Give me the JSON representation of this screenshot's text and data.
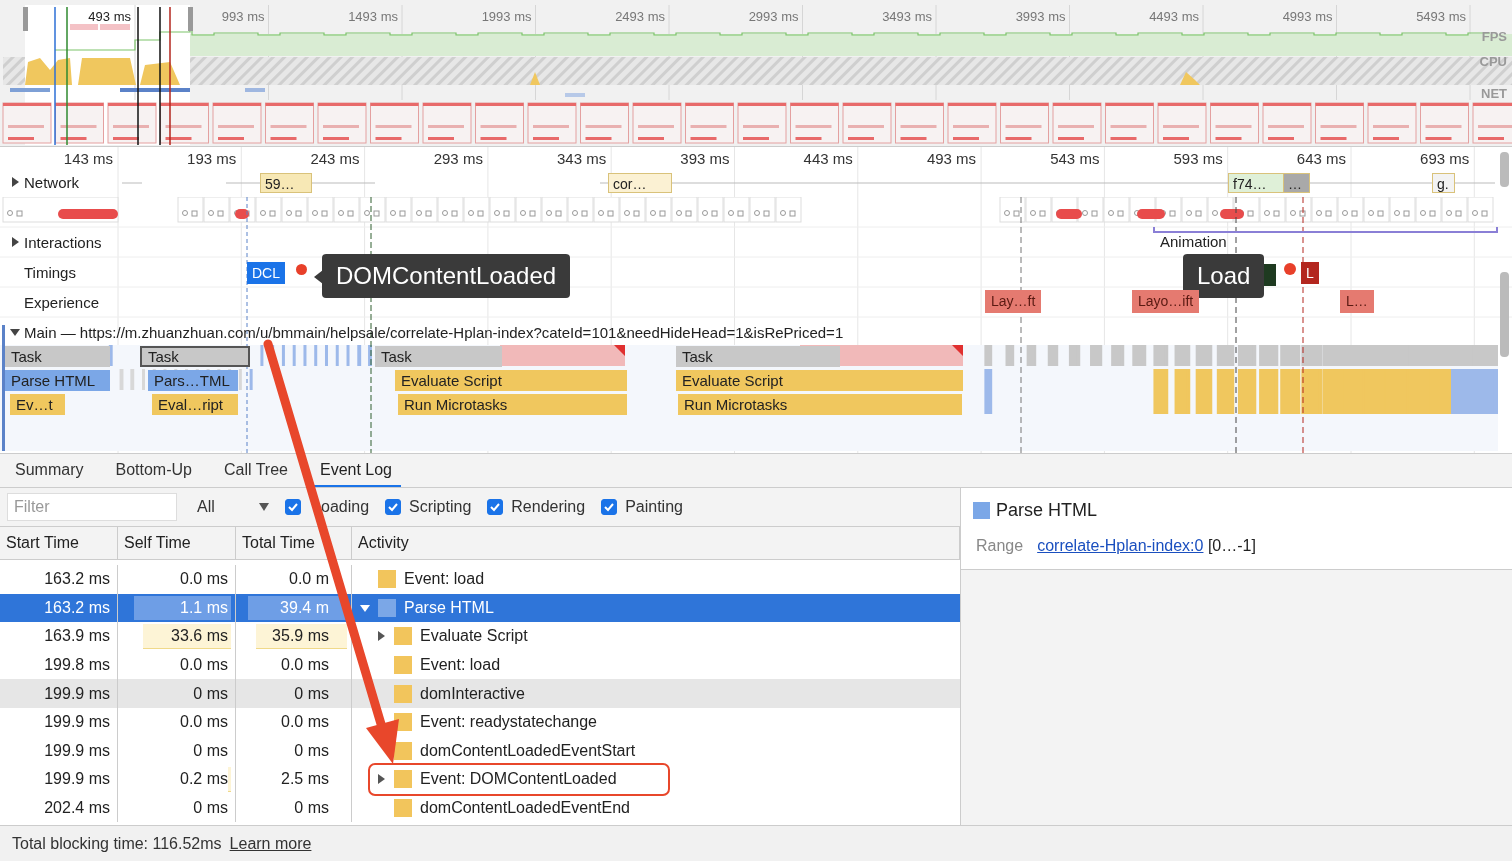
{
  "overview": {
    "selection_label": "493 ms",
    "ticks": [
      "993 ms",
      "1493 ms",
      "1993 ms",
      "2493 ms",
      "2993 ms",
      "3493 ms",
      "3993 ms",
      "4493 ms",
      "4993 ms",
      "5493 ms"
    ],
    "tracks": [
      "FPS",
      "CPU",
      "NET"
    ]
  },
  "flame": {
    "ticks": [
      "143 ms",
      "193 ms",
      "243 ms",
      "293 ms",
      "343 ms",
      "393 ms",
      "443 ms",
      "493 ms",
      "543 ms",
      "593 ms",
      "643 ms",
      "693 ms"
    ],
    "tracks": [
      {
        "label": "Network",
        "expanded": false
      },
      {
        "label": "Interactions",
        "expanded": false
      },
      {
        "label": "Timings"
      },
      {
        "label": "Experience"
      }
    ],
    "network_items": [
      {
        "label": "59…"
      },
      {
        "label": "cor…"
      },
      {
        "label": "f74…"
      },
      {
        "label": "…"
      },
      {
        "label": "g."
      }
    ],
    "interactions": [
      {
        "label": "Animation"
      }
    ],
    "timings": [
      {
        "label": "DCL",
        "color": "#1a73e8"
      },
      {
        "label": "L",
        "color": "#b3261e"
      }
    ],
    "tooltips": [
      "DOMContentLoaded",
      "Load"
    ],
    "experience": [
      "Lay…ft",
      "Layo…ift",
      "L…"
    ],
    "main": {
      "label": "Main — https://m.zhuanzhuan.com/u/bmmain/helpsale/correlate-Hplan-index?cateId=101&needHideHead=1&isRePriced=1",
      "expanded": true,
      "tasks": [
        {
          "blocks": [
            "Task",
            "Parse HTML",
            "Ev…t"
          ],
          "selected": false
        },
        {
          "blocks": [
            "Task",
            "Pars…TML",
            "Eval…ript"
          ],
          "selected": true
        },
        {
          "blocks": [
            "Task",
            "Evaluate Script",
            "Run Microtasks"
          ],
          "selected": false
        },
        {
          "blocks": [
            "Task",
            "Evaluate Script",
            "Run Microtasks"
          ],
          "selected": false
        }
      ]
    }
  },
  "tabs": [
    {
      "label": "Summary",
      "selected": false
    },
    {
      "label": "Bottom-Up",
      "selected": false
    },
    {
      "label": "Call Tree",
      "selected": false
    },
    {
      "label": "Event Log",
      "selected": true
    }
  ],
  "filter": {
    "placeholder": "Filter",
    "category": "All",
    "checks": [
      {
        "label": "oading",
        "checked": true
      },
      {
        "label": "Scripting",
        "checked": true
      },
      {
        "label": "Rendering",
        "checked": true
      },
      {
        "label": "Painting",
        "checked": true
      }
    ]
  },
  "table": {
    "columns": [
      "Start Time",
      "Self Time",
      "Total Time",
      "Activity"
    ],
    "rows": [
      {
        "start": "163.2 ms",
        "self": {
          "text": "0.0 ms"
        },
        "total": {
          "text": "0.0 m"
        },
        "activity": "Event: load",
        "color": "#f2c55c",
        "selected": false,
        "hovered": false,
        "circled": false
      },
      {
        "start": "163.2 ms",
        "self": {
          "text": "1.1 ms",
          "level": 0.9
        },
        "total": {
          "text": "39.4 m",
          "level": 0.93
        },
        "activity": "Parse HTML",
        "color": "#7ba7e7",
        "expanded": true,
        "selected": true,
        "hovered": false,
        "circled": false,
        "children": [
          {
            "start": "163.9 ms",
            "self": {
              "text": "33.6 ms",
              "level": 0.82
            },
            "total": {
              "text": "35.9 ms",
              "level": 0.86
            },
            "activity": "Evaluate Script",
            "color": "#f2c55c",
            "expanded": false,
            "selected": false,
            "hovered": false,
            "circled": false
          },
          {
            "start": "199.8 ms",
            "self": {
              "text": "0.0 ms"
            },
            "total": {
              "text": "0.0 ms"
            },
            "activity": "Event: load",
            "color": "#f2c55c",
            "selected": false,
            "hovered": false,
            "circled": false
          },
          {
            "start": "199.9 ms",
            "self": {
              "text": "0 ms"
            },
            "total": {
              "text": "0 ms"
            },
            "activity": "domInteractive",
            "color": "#f2c55c",
            "selected": false,
            "hovered": true,
            "circled": false
          },
          {
            "start": "199.9 ms",
            "self": {
              "text": "0.0 ms"
            },
            "total": {
              "text": "0.0 ms"
            },
            "activity": "Event: readystatechange",
            "color": "#f2c55c",
            "selected": false,
            "hovered": false,
            "circled": false
          },
          {
            "start": "199.9 ms",
            "self": {
              "text": "0 ms"
            },
            "total": {
              "text": "0 ms"
            },
            "activity": "domContentLoadedEventStart",
            "color": "#f2c55c",
            "selected": false,
            "hovered": false,
            "circled": false
          },
          {
            "start": "199.9 ms",
            "self": {
              "text": "0.2 ms",
              "level": 0.03
            },
            "total": {
              "text": "2.5 ms"
            },
            "activity": "Event: DOMContentLoaded",
            "color": "#f2c55c",
            "expanded": false,
            "selected": false,
            "hovered": false,
            "circled": true
          },
          {
            "start": "202.4 ms",
            "self": {
              "text": "0 ms"
            },
            "total": {
              "text": "0 ms"
            },
            "activity": "domContentLoadedEventEnd",
            "color": "#f2c55c",
            "selected": false,
            "hovered": false,
            "circled": false
          }
        ]
      }
    ]
  },
  "details": {
    "title": "Parse HTML",
    "color": "#7ba7e7",
    "range_label": "Range",
    "link": "correlate-Hplan-index:0",
    "range": "[0…-1]"
  },
  "footer": {
    "text": "Total blocking time: 116.52ms",
    "link": "Learn more"
  }
}
